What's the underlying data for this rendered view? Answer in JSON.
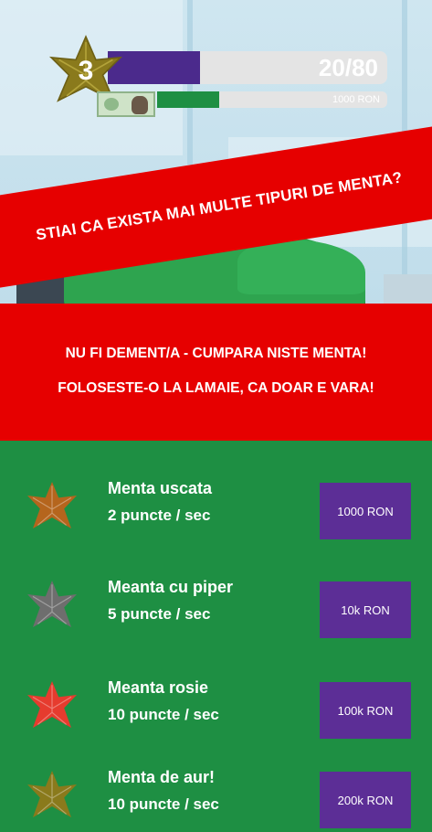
{
  "hud": {
    "level": "3",
    "xp_text": "20/80",
    "xp_progress": 0.33,
    "money_text": "1000 RON",
    "money_progress": 0.27,
    "colors": {
      "xp_fill": "#4b2a8c",
      "money_fill": "#1e8f43",
      "level_star": "#8a7a1c"
    }
  },
  "fact_banner": {
    "text": "STIAI CA EXISTA MAI MULTE TIPURI DE MENTA?"
  },
  "promo": {
    "line1": "NU FI DEMENT/A - CUMPARA NISTE MENTA!",
    "line2": "FOLOSESTE-O LA LAMAIE, CA DOAR E VARA!"
  },
  "shop": {
    "items": [
      {
        "name": "Menta uscata",
        "rate": "2 puncte / sec",
        "price": "1000 RON",
        "icon": "brown-mint-leaf-icon",
        "color": "#b5651d"
      },
      {
        "name": "Meanta cu piper",
        "rate": "5 puncte / sec",
        "price": "10k RON",
        "icon": "grey-mint-leaf-icon",
        "color": "#6e6e6e"
      },
      {
        "name": "Meanta rosie",
        "rate": "10 puncte / sec",
        "price": "100k RON",
        "icon": "red-mint-leaf-icon",
        "color": "#e63b2e"
      },
      {
        "name": "Menta de aur!",
        "rate": "10 puncte / sec",
        "price": "200k RON",
        "icon": "gold-mint-leaf-icon",
        "color": "#8a7a1c"
      }
    ]
  }
}
